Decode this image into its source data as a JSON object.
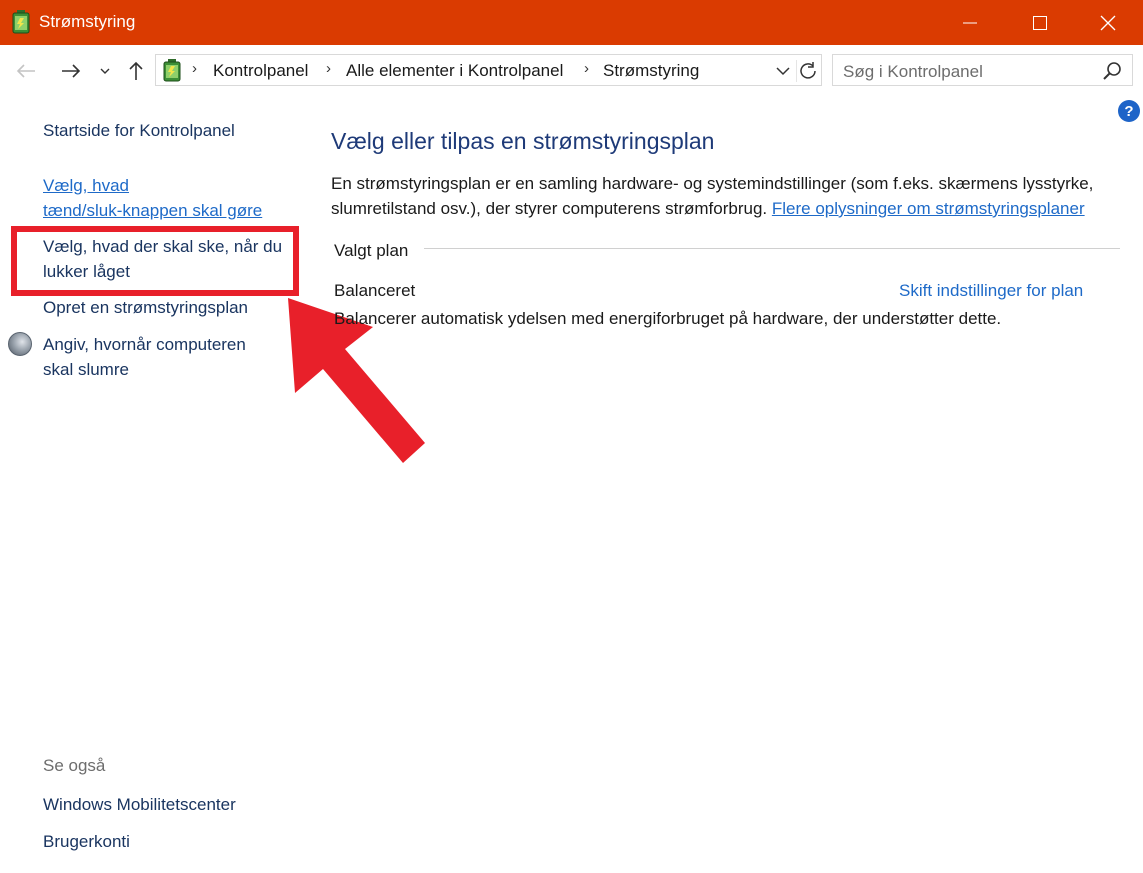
{
  "window": {
    "title": "Strømstyring",
    "titlebar_color": "#da3b01"
  },
  "navigation": {
    "breadcrumbs": [
      "Kontrolpanel",
      "Alle elementer i Kontrolpanel",
      "Strømstyring"
    ],
    "search_placeholder": "Søg i Kontrolpanel"
  },
  "sidebar": {
    "home": "Startside for Kontrolpanel",
    "power_button_line1": "Vælg, hvad",
    "power_button_line2": "tænd/sluk-knappen skal gøre",
    "lid_line1": "Vælg, hvad der skal ske, når du",
    "lid_line2": "lukker låget",
    "create_plan": "Opret en strømstyringsplan",
    "sleep_line1": "Angiv, hvornår computeren",
    "sleep_line2": "skal slumre",
    "see_also_label": "Se også",
    "see_also": [
      "Windows Mobilitetscenter",
      "Brugerkonti"
    ]
  },
  "main": {
    "title": "Vælg eller tilpas en strømstyringsplan",
    "description": "En strømstyringsplan er en samling hardware- og systemindstillinger (som f.eks. skærmens lysstyrke, slumretilstand osv.), der styrer computerens strømforbrug.",
    "more_info_link": "Flere oplysninger om strømstyringsplaner",
    "section_label": "Valgt plan",
    "plan": {
      "name": "Balanceret",
      "change_link": "Skift indstillinger for plan",
      "description": "Balancerer automatisk ydelsen med energiforbruget på hardware, der understøtter dette."
    }
  },
  "annotation": {
    "highlight_color": "#e8202a"
  }
}
